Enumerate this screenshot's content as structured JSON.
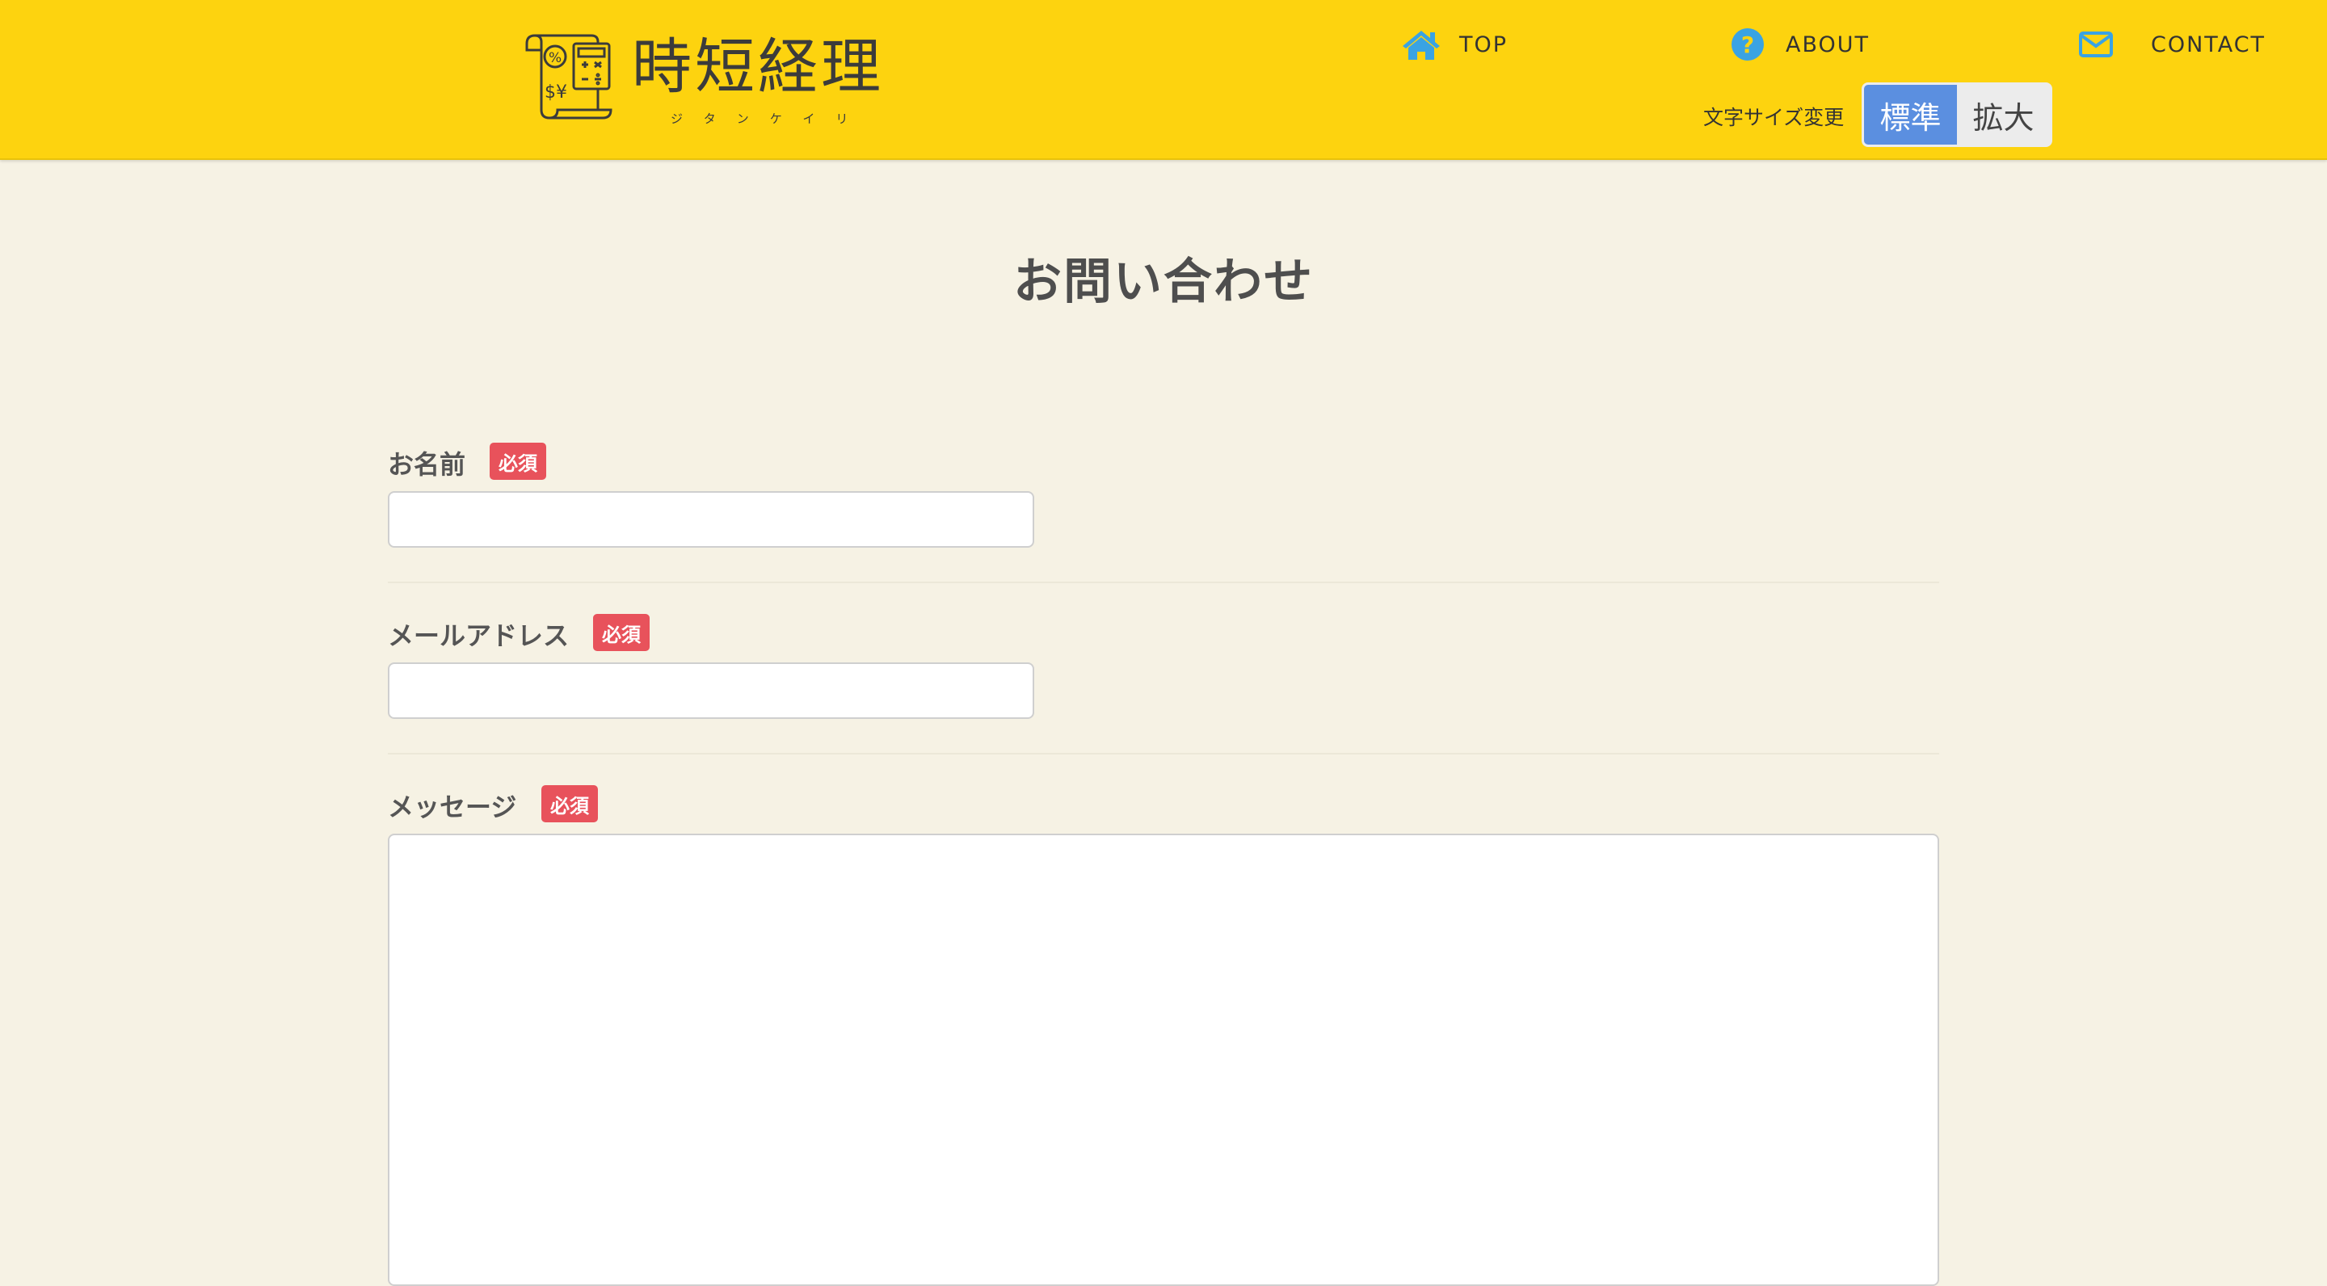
{
  "header": {
    "logo": {
      "title": "時短経理",
      "reading": "ジタンケイリ"
    },
    "nav": [
      {
        "label": "TOP",
        "icon": "home-icon"
      },
      {
        "label": "ABOUT",
        "icon": "question-circle-icon"
      },
      {
        "label": "CONTACT",
        "icon": "envelope-icon"
      }
    ],
    "font_size": {
      "label": "文字サイズ変更",
      "options": [
        "標準",
        "拡大"
      ],
      "selected": "標準"
    }
  },
  "main": {
    "title": "お問い合わせ",
    "form": {
      "name": {
        "label": "お名前",
        "badge": "必須",
        "value": ""
      },
      "email": {
        "label": "メールアドレス",
        "badge": "必須",
        "value": ""
      },
      "message": {
        "label": "メッセージ",
        "badge": "必須",
        "value": ""
      }
    }
  },
  "colors": {
    "header_bg": "#fdd30f",
    "page_bg": "#f6f2e4",
    "nav_icon": "#3aa3e3",
    "badge": "#e8525b",
    "toggle_active": "#5b8fe0"
  }
}
